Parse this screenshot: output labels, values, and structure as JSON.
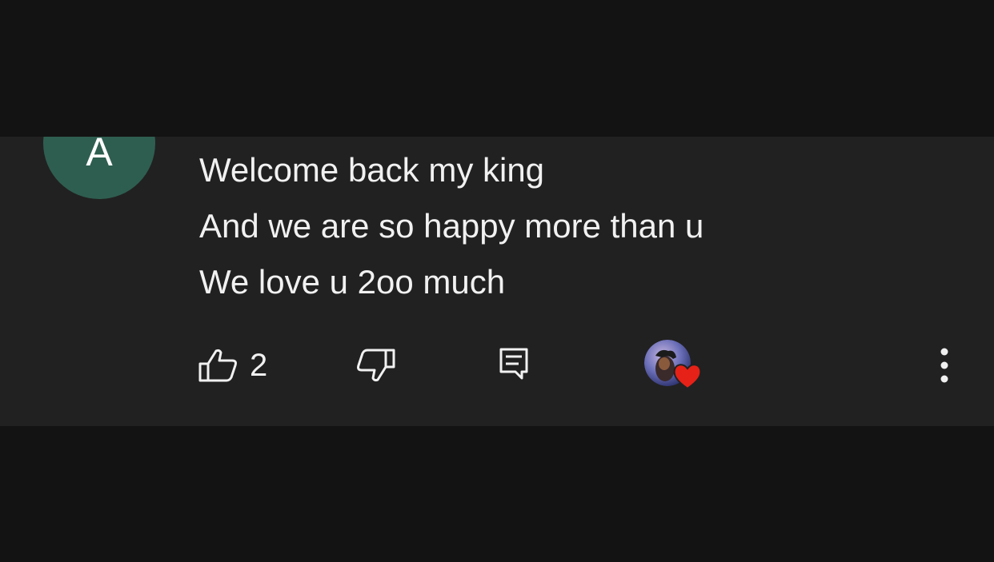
{
  "comment": {
    "author_initial": "A",
    "lines": [
      "Welcome back my king",
      "And we are so happy more than u",
      "We love u 2oo much"
    ]
  },
  "actions": {
    "like_count": "2",
    "icons": {
      "like": "thumbs-up-icon",
      "dislike": "thumbs-down-icon",
      "reply": "reply-comment-icon",
      "creator_heart": "creator-heart-icon",
      "more": "more-vertical-icon"
    }
  },
  "colors": {
    "background": "#131313",
    "card": "#212121",
    "avatar": "#2e5e50",
    "text": "#f1f1f1",
    "heart": "#e62117"
  }
}
